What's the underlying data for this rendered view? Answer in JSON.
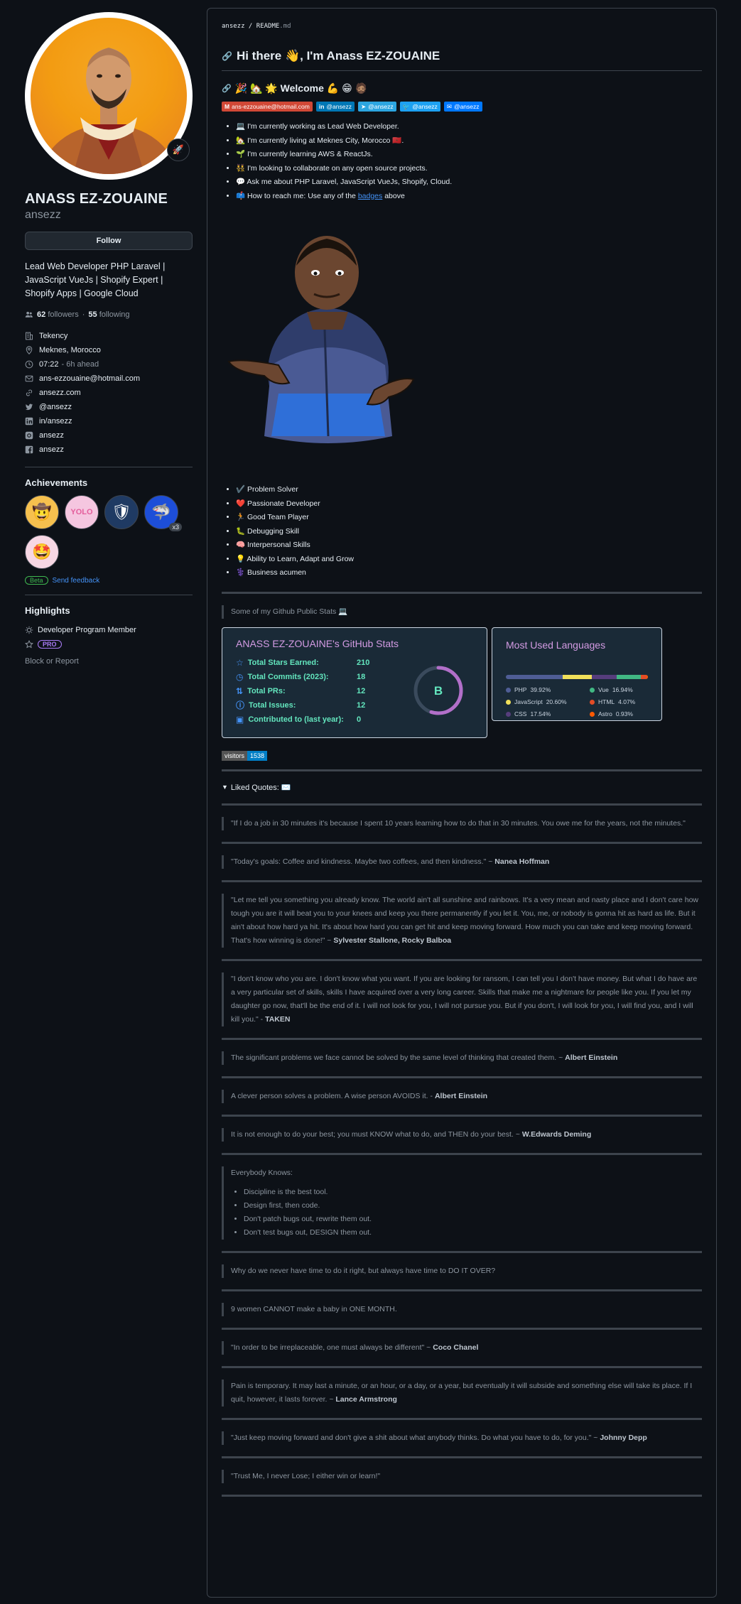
{
  "profile": {
    "fullname": "ANASS EZ-ZOUAINE",
    "username": "ansezz",
    "follow_label": "Follow",
    "bio": "Lead Web Developer PHP Laravel | JavaScript VueJs | Shopify Expert | Shopify Apps | Google Cloud",
    "followers": "62",
    "followers_label": "followers",
    "following": "55",
    "following_label": "following",
    "details": {
      "company": "Tekency",
      "location": "Meknes, Morocco",
      "time": "07:22",
      "time_note": "- 6h ahead",
      "email": "ans-ezzouaine@hotmail.com",
      "website": "ansezz.com",
      "twitter": "@ansezz",
      "linkedin": "in/ansezz",
      "instagram": "ansezz",
      "facebook": "ansezz"
    },
    "achievements_title": "Achievements",
    "achievement_count": "x3",
    "beta_label": "Beta",
    "feedback_label": "Send feedback",
    "highlights_title": "Highlights",
    "highlight_member": "Developer Program Member",
    "pro_label": "PRO",
    "block_label": "Block or Report"
  },
  "readme": {
    "crumb_user": "ansezz",
    "crumb_sep": " / ",
    "crumb_file": "README",
    "crumb_ext": ".md",
    "title": "Hi there 👋, I'm Anass EZ-ZOUAINE",
    "welcome": "🎉 🏡 🌟 Welcome 💪 😁 🧔🏽",
    "badges": [
      {
        "label": "ans-ezzouaine@hotmail.com",
        "color": "#d14836"
      },
      {
        "label": "@ansezz",
        "color": "#0077b5"
      },
      {
        "label": "@ansezz",
        "color": "#2ca5e0"
      },
      {
        "label": "@ansezz",
        "color": "#1da1f2"
      },
      {
        "label": "@ansezz",
        "color": "#0078ff"
      }
    ],
    "intro": [
      "💻 I'm currently working as Lead Web Developer.",
      "🏡 I'm currently living at Meknes City, Morocco 🇲🇦.",
      "🌱 I'm currently learning AWS & ReactJs.",
      "👯 I'm looking to collaborate on any open source projects.",
      "💬 Ask me about PHP Laravel, JavaScript VueJs, Shopify, Cloud.",
      "📫 How to reach me: Use any of the ",
      "badges",
      " above"
    ],
    "skills": [
      "✔️ Problem Solver",
      "❤️ Passionate Developer",
      "🏃 Good Team Player",
      "🐛 Debugging Skill",
      "🧠 Interpersonal Skills",
      "💡 Ability to Learn, Adapt and Grow",
      "⚕️ Business acumen"
    ],
    "stats_caption": "Some of my Github Public Stats 💻",
    "stats_card": {
      "title": "ANASS EZ-ZOUAINE's GitHub Stats",
      "rows": [
        {
          "label": "Total Stars Earned:",
          "value": "210"
        },
        {
          "label": "Total Commits (2023):",
          "value": "18"
        },
        {
          "label": "Total PRs:",
          "value": "12"
        },
        {
          "label": "Total Issues:",
          "value": "12"
        },
        {
          "label": "Contributed to (last year):",
          "value": "0"
        }
      ],
      "rank": "B",
      "rank_progress": 0.55
    },
    "langs_card": {
      "title": "Most Used Languages",
      "items": [
        {
          "name": "PHP",
          "pct": "39.92%",
          "value": 39.92,
          "color": "#4f5d95"
        },
        {
          "name": "Vue",
          "pct": "16.94%",
          "value": 16.94,
          "color": "#41b883"
        },
        {
          "name": "JavaScript",
          "pct": "20.60%",
          "value": 20.6,
          "color": "#f1e05a"
        },
        {
          "name": "HTML",
          "pct": "4.07%",
          "value": 4.07,
          "color": "#e34c26"
        },
        {
          "name": "CSS",
          "pct": "17.54%",
          "value": 17.54,
          "color": "#563d7c"
        },
        {
          "name": "Astro",
          "pct": "0.93%",
          "value": 0.93,
          "color": "#ff5a03"
        }
      ]
    },
    "visitors_label": "visitors",
    "visitors_count": "1538",
    "quotes_summary": "Liked Quotes: ✉️",
    "quotes": [
      {
        "text": "\"If I do a job in 30 minutes it's because I spent 10 years learning how to do that in 30 minutes. You owe me for the years, not the minutes.\"",
        "author": ""
      },
      {
        "text": "\"Today's goals: Coffee and kindness. Maybe two coffees, and then kindness.\" ~ ",
        "author": "Nanea Hoffman"
      },
      {
        "text": "\"Let me tell you something you already know. The world ain't all sunshine and rainbows. It's a very mean and nasty place and I don't care how tough you are it will beat you to your knees and keep you there permanently if you let it. You, me, or nobody is gonna hit as hard as life. But it ain't about how hard ya hit. It's about how hard you can get hit and keep moving forward. How much you can take and keep moving forward. That's how winning is done!\" ~ ",
        "author": "Sylvester Stallone, Rocky Balboa"
      },
      {
        "text": "\"I don't know who you are. I don't know what you want. If you are looking for ransom, I can tell you I don't have money. But what I do have are a very particular set of skills, skills I have acquired over a very long career. Skills that make me a nightmare for people like you. If you let my daughter go now, that'll be the end of it. I will not look for you, I will not pursue you. But if you don't, I will look for you, I will find you, and I will kill you.\" - ",
        "author": "TAKEN"
      },
      {
        "text": "The significant problems we face cannot be solved by the same level of thinking that created them. ~ ",
        "author": "Albert Einstein"
      },
      {
        "text": "A clever person solves a problem. A wise person AVOIDS it. - ",
        "author": "Albert Einstein"
      },
      {
        "text": "It is not enough to do your best; you must KNOW what to do, and THEN do your best. ~ ",
        "author": "W.Edwards Deming"
      }
    ],
    "everybody_knows": {
      "title": "Everybody Knows:",
      "items": [
        "Discipline is the best tool.",
        "Design first, then code.",
        "Don't patch bugs out, rewrite them out.",
        "Don't test bugs out, DESIGN them out."
      ]
    },
    "quotes2": [
      {
        "text": "Why do we never have time to do it right, but always have time to DO IT OVER?",
        "author": ""
      },
      {
        "text": "9 women CANNOT make a baby in ONE MONTH.",
        "author": ""
      },
      {
        "text": "\"In order to be irreplaceable, one must always be different\" ~ ",
        "author": "Coco Chanel"
      },
      {
        "text": "Pain is temporary. It may last a minute, or an hour, or a day, or a year, but eventually it will subside and something else will take its place. If I quit, however, it lasts forever. ~ ",
        "author": "Lance Armstrong"
      },
      {
        "text": "\"Just keep moving forward and don't give a shit about what anybody thinks. Do what you have to do, for you.\" ~ ",
        "author": "Johnny Depp"
      },
      {
        "text": "\"Trust Me, I never Lose; I either win or learn!\"",
        "author": ""
      }
    ]
  }
}
